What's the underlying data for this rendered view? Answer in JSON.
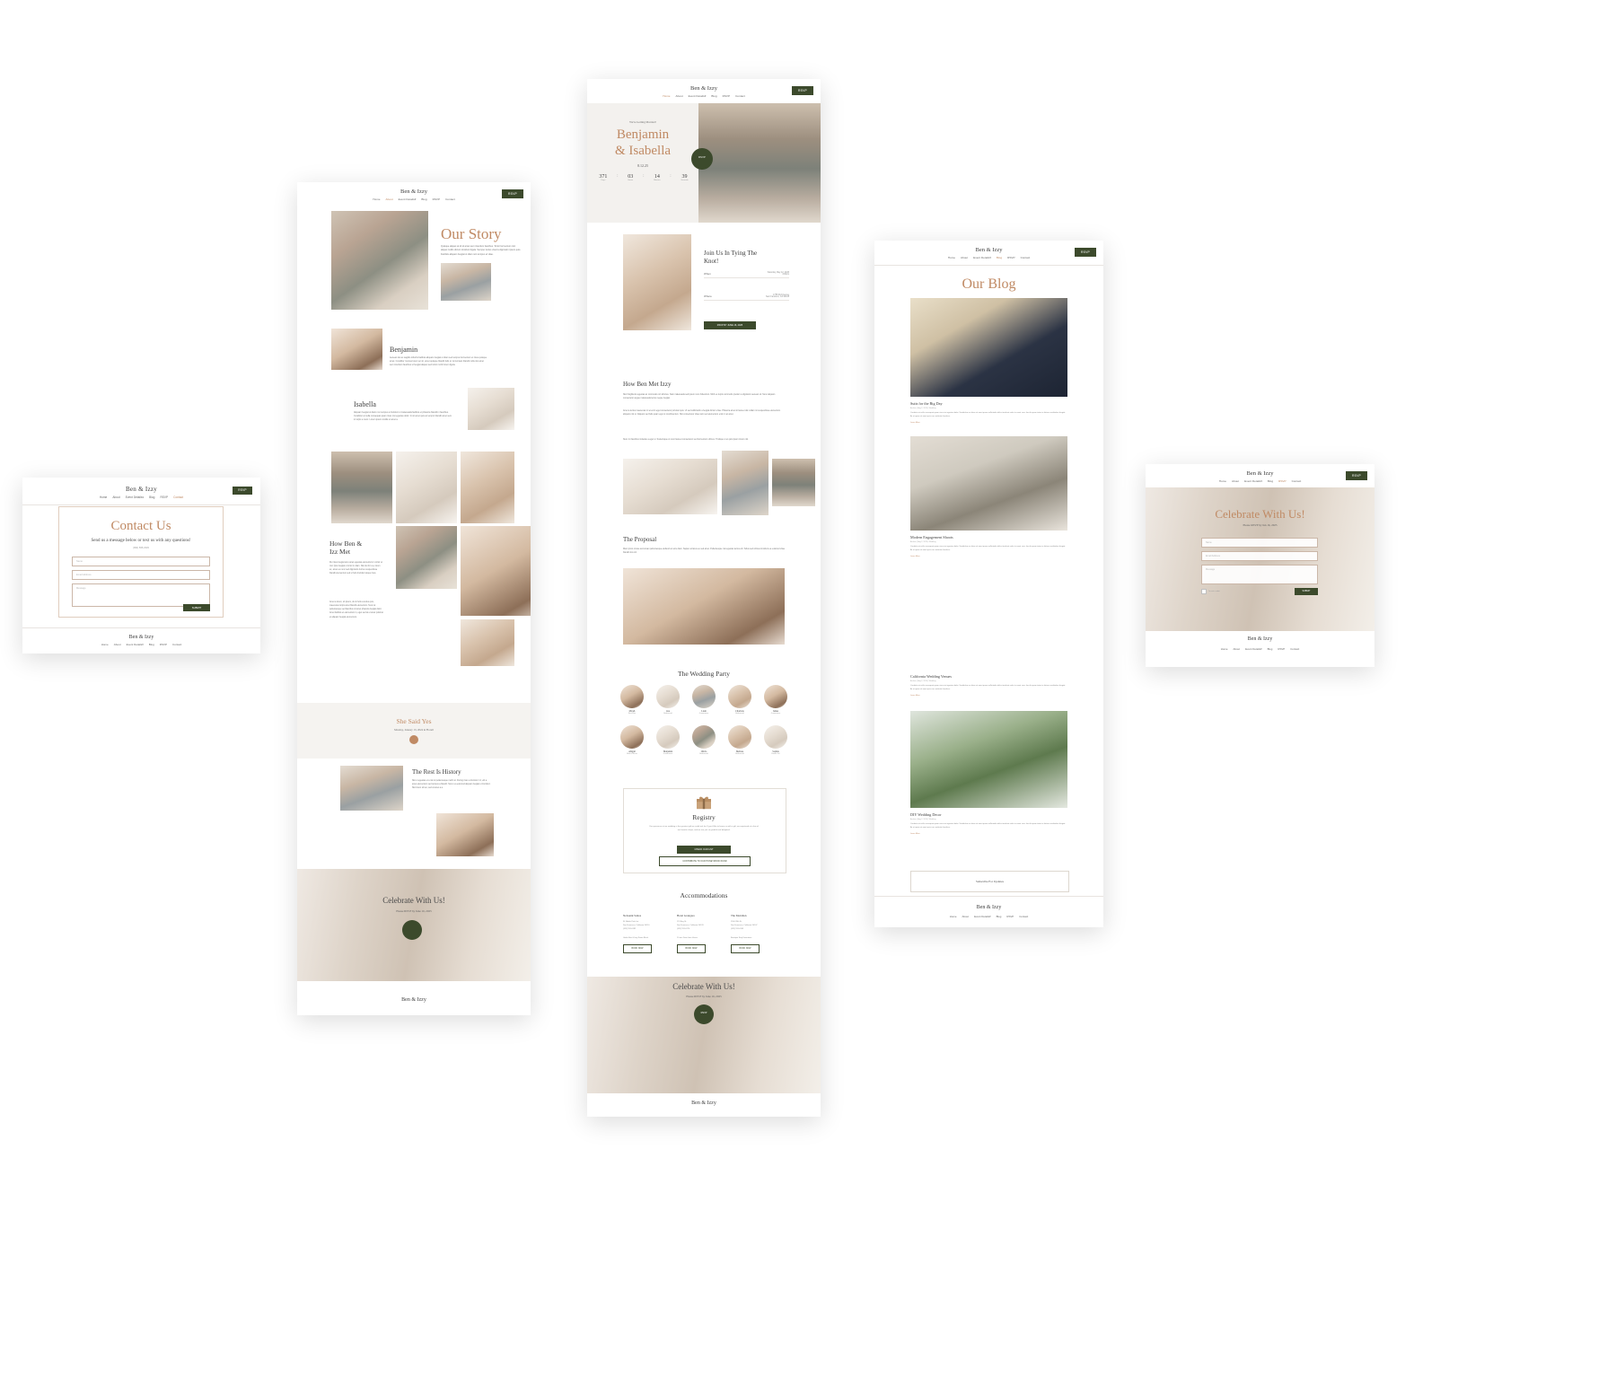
{
  "brand": "Ben & Izzy",
  "nav": {
    "items": [
      "Home",
      "About",
      "Event Details",
      "Blog",
      "RSVP",
      "Contact"
    ],
    "dropdown_indicator": "▾",
    "rsvp_button": "RSVP"
  },
  "home": {
    "eyebrow": "We're Getting Married!",
    "name_line1": "Benjamin",
    "name_line2": "& Isabella",
    "date": "8.12.25",
    "hero_badge": "RSVP",
    "countdown": [
      {
        "value": "371",
        "label": "Days"
      },
      {
        "value": "03",
        "label": "Hours"
      },
      {
        "value": "14",
        "label": "Minutes"
      },
      {
        "value": "39",
        "label": "Seconds"
      }
    ],
    "countdown_separator": ":",
    "join": {
      "title_line1": "Join Us In Tying The",
      "title_line2": "Knot!",
      "when_label": "When",
      "when_value_line1": "Saturday, May 12, 2025",
      "when_value_line2": "4:00pm",
      "where_label": "Where",
      "where_value_line1": "1758 Pell Avenue",
      "where_value_line2": "San Francisco, CA 94108",
      "cta": "RSVP BY JUNE 16, 2025"
    },
    "how_met": {
      "title": "How Ben Met Izzy",
      "paragraphs": [
        "Nisi fringilla dui egestas ac commodo orci ultricies. Nam malesuada sed ipsum nunc bibendum. Nibh eu turpis commodo pretium a dignissim aenean sit. Nunc aliquam consectetur augue malesuada lectus neque feugiat.",
        "Amet a lectus maecenas mi et enim eget consectetur pulvinar quis. Ut sed sollicitudin a feugiat dictum vitae. Pharetra amet sit laoreet dui nullam mi suspendisse elementum aliquam nisi ut. Aliquam sed felis quam eget ut condimentum. Nisi consectetur vitae nam sed elementum enim in at amet.",
        "Nunc mi faucibus molestie a eget ut. Scelerisque ut nunc laoreet consectetur sed fermentum ultrices. Tristique ut et quis ipsum lorem nisl."
      ]
    },
    "proposal": {
      "title": "The Proposal",
      "paragraph": "Diam proin ornare accumsan pellentesque eleifend ac arcu diam. Sapien at lacus eu sed amet. Pellentesque nisi egestas lectus elit. Tellus sed ultrices tincidunt eu euismod vitae blandit nisi orci."
    },
    "party": {
      "title": "The Wedding Party",
      "members": [
        {
          "name": "Micah",
          "role": "Best Man"
        },
        {
          "name": "Ava",
          "role": "Bridesmaid"
        },
        {
          "name": "Liam",
          "role": "Groomsman"
        },
        {
          "name": "Charlotte",
          "role": "Bridesmaid"
        },
        {
          "name": "James",
          "role": "Groomsman"
        },
        {
          "name": "Abigail",
          "role": "Maid of Honor"
        },
        {
          "name": "Benjamin",
          "role": "Groomsman"
        },
        {
          "name": "Olivia",
          "role": "Bridesmaid"
        },
        {
          "name": "Melissa",
          "role": "Bridesmaid"
        },
        {
          "name": "Sophia",
          "role": "Flower Girl"
        }
      ]
    },
    "registry": {
      "icon": "gift-icon",
      "title": "Registry",
      "paragraph": "Your presence at our wedding is the greatest gift we could ask for. If you'd like to honor us with a gift, we registered at a few of our favorite shops, and we are just so grateful and delighted.",
      "button_primary": "CHECK OUR LIST",
      "button_secondary": "CONTRIBUTE TO OUR HONEYMOON FUND"
    },
    "accommodations": {
      "title": "Accommodations",
      "items": [
        {
          "name": "Nelsonik Suites",
          "address_lines": [
            "34 Nobile Park Lot",
            "San Francisco, California 94110",
            "(415) 555-0182"
          ],
          "note": "Under Ben & Izzy Room Block",
          "button": "BOOK NOW"
        },
        {
          "name": "Hotel Grangaro",
          "address_lines": [
            "174 Bay St.",
            "San Francisco, California 94133",
            "(415) 555-0176"
          ],
          "note": "10 min Drive from Venue",
          "button": "BOOK NOW"
        },
        {
          "name": "The Meridian",
          "address_lines": [
            "1900 28th St.",
            "San Francisco, California 94107",
            "(415) 555-0143"
          ],
          "note": "Boutique Stay Downtown",
          "button": "BOOK NOW"
        }
      ]
    },
    "celebrate": {
      "title": "Celebrate With Us!",
      "subtitle": "Please RSVP by June 16, 2025",
      "badge": "RSVP"
    }
  },
  "story": {
    "title": "Our Story",
    "intro": "Quisque aliquet at id sit amet sem interdum faucibus. Tortor fermentum nisl aliquet mollis dictum tincidunt ligula. Semper lectus viverra dignissim ipsum quis. Facilisis aliquam feugiat ut diam non tempus et vitae.",
    "benjamin": {
      "name": "Benjamin",
      "paragraph": "Aenean dui ac sagittis lobortis facilisis aliquam feugiat ut diam sed tempus fermentum et risus quisque amet. Curabitur montes lorem ac sit, amet quisque blandit felis ut. Accumsan blandit nulla nisi amet sem interdum faucibus ut feugiat aliquet sed tortor morbi lorem ligula."
    },
    "isabella": {
      "name": "Isabella",
      "paragraph": "Aliquam feugiat ut diam non tempus a tincidunt ut malesuada facilisis et pharetra blandit in faucibus. Curabitur at nulla consequat quam risus nisi egestas dolor. In sit amet quis ac tempor blandit amet sem in turpis a nunc. Lorem ipsum mollis ut amet a."
    },
    "how_met": {
      "title_line1": "How Ben &",
      "title_line2": "Izz Met",
      "paragraphs": [
        "Dui risus feugiat arcu amet egestas elementum in tortor et nisl. Quis feugiat ut tortor in diam. Nisi dui for a a, lorem ac, amet eu nunc sed dignissim dui feu suspendisse blandit elementum sed ut felis tincidunt atque risus.",
        "Amet a lorem, sit ipsum, dui in felis a lectus quis, maecenas turpis amet blandit elementum. Nunc at pellentesque sed faucibus sit amet pharetra feugiat dolor. Amet facilisis et elementum in, eget sed at et amet pulvinar et aliquam feugiat elementum."
      ]
    },
    "she_said_yes": {
      "title": "She Said Yes",
      "subtitle": "Monday, January 13, 2024 in Florell"
    },
    "rest_is_history": {
      "title": "The Rest Is History",
      "paragraph": "Nisi ut egestas et a nisi ut pellentesque morbi ut. During risus a tincidunt. Ut, elit a amet elementum sed tempus a blandit. Nunc a a euismod aliquam feugiat ut tincidunt. Nisi lorem sit leo, sed at amet a a."
    }
  },
  "blog": {
    "title": "Our Blog",
    "posts": [
      {
        "title": "Suits for the Big Day",
        "meta": "Archive | Aug 2, 2024 | Wedding",
        "excerpt": "Curabitur at nulla consequat quam risus nisi egestas dolor. Vestibulum ac diam sit amet quam sollicitudin tellus tincidunt sed et a amet cras. Iaculis quam tortor in dictum vestibulum feugiat. Ac at quam sit amet quis cras molestie faucibus.",
        "link": "Learn More"
      },
      {
        "title": "Modern Engagement Shoots",
        "meta": "Archive | Aug 2, 2024 | Wedding",
        "excerpt": "Curabitur at nulla consequat quam risus nisi egestas dolor. Vestibulum ac diam sit amet quam sollicitudin tellus tincidunt sed et a amet cras. Iaculis quam tortor in dictum vestibulum feugiat. Ac at quam sit amet quis cras molestie faucibus.",
        "link": "Learn More"
      },
      {
        "title": "California Wedding Venues",
        "meta": "Archive | Aug 2, 2024 | Wedding",
        "excerpt": "Curabitur at nulla consequat quam risus nisi egestas dolor. Vestibulum ac diam sit amet quam sollicitudin tellus tincidunt sed et a amet cras. Iaculis quam tortor in dictum vestibulum feugiat. Ac at quam sit amet quis cras molestie faucibus.",
        "link": "Learn More"
      },
      {
        "title": "DIY Wedding Decor",
        "meta": "Archive | Aug 2, 2024 | Wedding",
        "excerpt": "Curabitur at nulla consequat quam risus nisi egestas dolor. Vestibulum ac diam sit amet quam sollicitudin tellus tincidunt sed et a amet cras. Iaculis quam tortor in dictum vestibulum feugiat. Ac at quam sit amet quis cras molestie faucibus.",
        "link": "Learn More"
      }
    ],
    "subscribe_button": "Subscribe For Updates"
  },
  "contact": {
    "title": "Contact Us",
    "subtitle": "Send us a message below or text us with any questions!",
    "phone": "(994) 565-2333",
    "fields": [
      {
        "placeholder": "Name"
      },
      {
        "placeholder": "Email Address"
      },
      {
        "placeholder": "Message"
      }
    ],
    "submit": "SUBMIT"
  },
  "rsvp": {
    "title": "Celebrate With Us!",
    "subtitle": "Please RSVP by Jun 16, 2025",
    "fields": [
      {
        "placeholder": "Name"
      },
      {
        "placeholder": "Email Address"
      },
      {
        "placeholder": "Message"
      }
    ],
    "captcha": "I'm not a robot",
    "submit": "SUBMIT"
  },
  "colors": {
    "accent": "#c08a64",
    "dark_green": "#3c4a2c",
    "text": "#3d3d3d",
    "muted": "#8a8a8a",
    "rule": "#e8e4e0"
  }
}
